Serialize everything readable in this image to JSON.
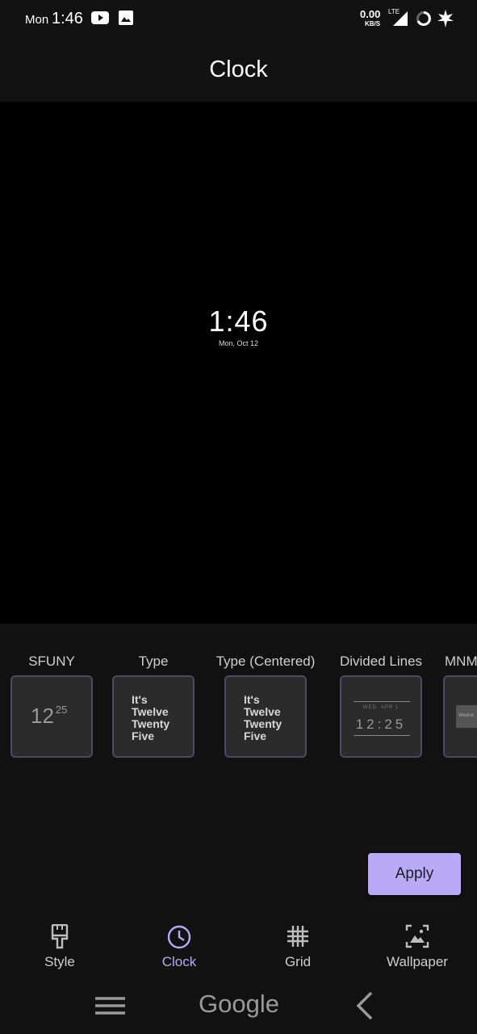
{
  "status_bar": {
    "day": "Mon",
    "time": "1:46",
    "net_speed": "0.00",
    "net_unit": "KB/S",
    "net_type": "LTE",
    "icons": [
      "youtube-icon",
      "image-icon",
      "signal-icon",
      "battery-ring-icon",
      "leaf-icon"
    ]
  },
  "header": {
    "title": "Clock"
  },
  "preview": {
    "time": "1:46",
    "date": "Mon, Oct 12"
  },
  "clock_options": [
    {
      "label": "SFUNY",
      "thumb_hour": "12",
      "thumb_minute": "25"
    },
    {
      "label": "Type",
      "thumb_lines": [
        "It's",
        "Twelve",
        "Twenty",
        "Five"
      ]
    },
    {
      "label": "Type (Centered)",
      "thumb_lines": [
        "It's",
        "Twelve",
        "Twenty",
        "Five"
      ]
    },
    {
      "label": "Divided Lines",
      "thumb_date": "WED, APR 1",
      "thumb_time": "12:25"
    },
    {
      "label": "MNM",
      "thumb_text": "Wedne"
    }
  ],
  "apply_label": "Apply",
  "bottom_nav": [
    {
      "label": "Style",
      "icon": "brush-icon"
    },
    {
      "label": "Clock",
      "icon": "clock-icon",
      "active": true
    },
    {
      "label": "Grid",
      "icon": "grid-icon"
    },
    {
      "label": "Wallpaper",
      "icon": "wallpaper-icon"
    }
  ],
  "system_nav": {
    "center_label": "Google",
    "icons": [
      "menu-icon",
      "back-icon"
    ]
  },
  "colors": {
    "accent": "#b8aaf5",
    "background": "#121212",
    "preview_bg": "#000000"
  }
}
